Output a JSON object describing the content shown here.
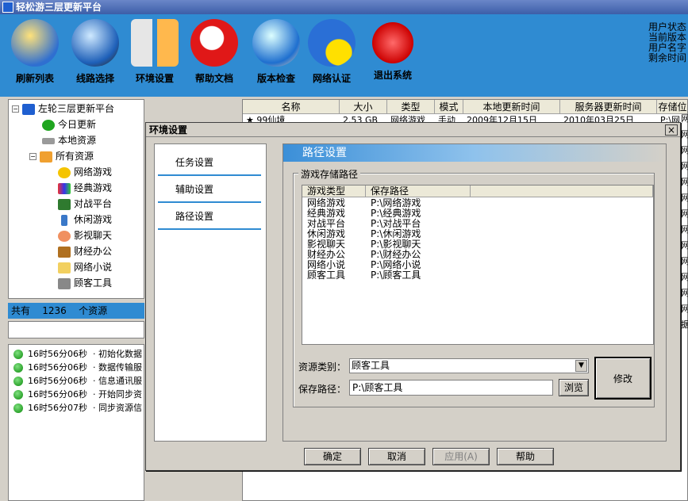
{
  "app": {
    "title": "轻松游三层更新平台"
  },
  "toolbar": {
    "items": [
      {
        "label": "刷新列表",
        "icon": "folder-refresh-icon"
      },
      {
        "label": "线路选择",
        "icon": "globe-gear-icon"
      },
      {
        "label": "环境设置",
        "icon": "tools-icon"
      },
      {
        "label": "帮助文档",
        "icon": "help-magnifier-icon"
      },
      {
        "label": "版本检查",
        "icon": "globe-satellite-icon"
      },
      {
        "label": "网络认证",
        "icon": "smiley-help-icon"
      },
      {
        "label": "退出系统",
        "icon": "power-icon"
      }
    ],
    "colors": {
      "bar": "#2f8bd2"
    }
  },
  "userinfo": {
    "lines": [
      "用户状态",
      "当前版本",
      "用户名字",
      "剩余时间"
    ]
  },
  "tree": {
    "root": "左轮三层更新平台",
    "items": [
      {
        "label": "今日更新",
        "icon": "check-icon"
      },
      {
        "label": "本地资源",
        "icon": "drive-icon"
      },
      {
        "label": "所有资源",
        "icon": "folder-icon"
      },
      {
        "label": "网络游戏",
        "icon": "star-icon"
      },
      {
        "label": "经典游戏",
        "icon": "colorful-icon"
      },
      {
        "label": "对战平台",
        "icon": "users-icon"
      },
      {
        "label": "休闲游戏",
        "icon": "bottle-icon"
      },
      {
        "label": "影视聊天",
        "icon": "chat-icon"
      },
      {
        "label": "财经办公",
        "icon": "abacus-icon"
      },
      {
        "label": "网络小说",
        "icon": "book-icon"
      },
      {
        "label": "顾客工具",
        "icon": "tools-small-icon"
      }
    ]
  },
  "status": {
    "prefix": "共有",
    "count": "1236",
    "suffix": "个资源"
  },
  "log": [
    {
      "time": "16时56分06秒",
      "msg": "· 初始化数据"
    },
    {
      "time": "16时56分06秒",
      "msg": "· 数据传输服"
    },
    {
      "time": "16时56分06秒",
      "msg": "· 信息通讯服"
    },
    {
      "time": "16时56分06秒",
      "msg": "· 开始同步资"
    },
    {
      "time": "16时56分07秒",
      "msg": "· 同步资源信"
    }
  ],
  "grid": {
    "columns": [
      "名称",
      "大小",
      "类型",
      "模式",
      "本地更新时间",
      "服务器更新时间",
      "存储位"
    ],
    "first_row": [
      "99仙境",
      "2.53 GB",
      "网络游戏",
      "手动",
      "2009年12月15日",
      "2010年03月25日",
      "P:\\网"
    ],
    "right_stub": [
      "P:\\网",
      "网",
      "网",
      "网",
      "网",
      "网",
      "网",
      "网",
      "网",
      "网",
      "网",
      "网",
      "网",
      "网",
      "据"
    ]
  },
  "dialog": {
    "title": "环境设置",
    "close": "×",
    "nav": [
      "任务设置",
      "辅助设置",
      "路径设置"
    ],
    "section_title": "路径设置",
    "group_label": "游戏存储路径",
    "table": {
      "headers": [
        "游戏类型",
        "保存路径"
      ],
      "rows": [
        [
          "网络游戏",
          "P:\\网络游戏"
        ],
        [
          "经典游戏",
          "P:\\经典游戏"
        ],
        [
          "对战平台",
          "P:\\对战平台"
        ],
        [
          "休闲游戏",
          "P:\\休闲游戏"
        ],
        [
          "影视聊天",
          "P:\\影视聊天"
        ],
        [
          "财经办公",
          "P:\\财经办公"
        ],
        [
          "网络小说",
          "P:\\网络小说"
        ],
        [
          "顾客工具",
          "P:\\顾客工具"
        ]
      ]
    },
    "category_label": "资源类别：",
    "category_value": "顾客工具",
    "path_label": "保存路径：",
    "path_value": "P:\\顾客工具",
    "browse": "浏览",
    "modify": "修改",
    "buttons": {
      "ok": "确定",
      "cancel": "取消",
      "apply": "应用(A)",
      "help": "帮助"
    }
  }
}
